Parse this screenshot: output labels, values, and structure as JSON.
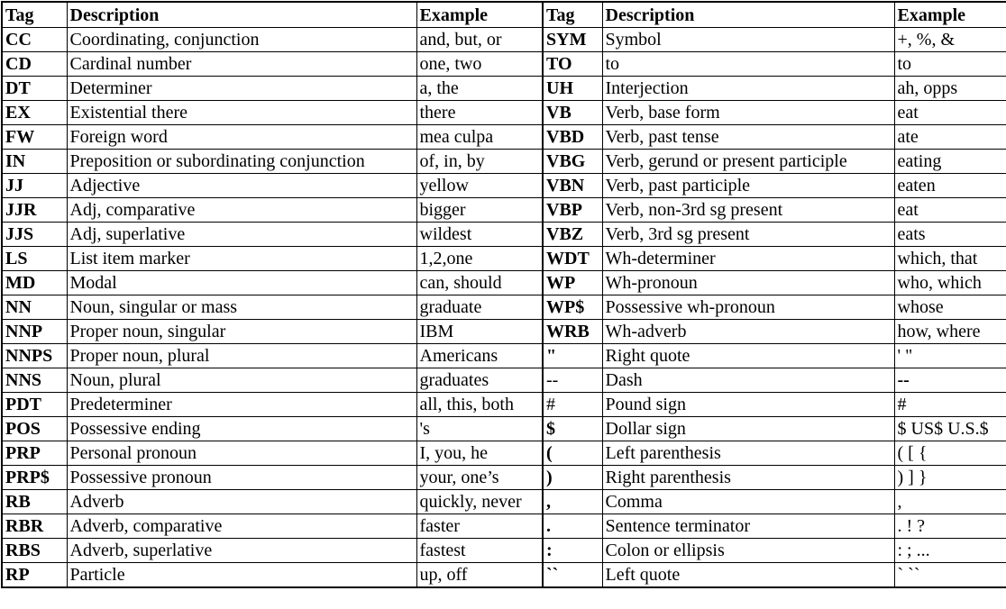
{
  "headers": [
    "Tag",
    "Description",
    "Example",
    "Tag",
    "Description",
    "Example"
  ],
  "rows": [
    {
      "l": {
        "tag": "CC",
        "desc": "Coordinating, conjunction",
        "ex": "and, but, or"
      },
      "r": {
        "tag": "SYM",
        "desc": "Symbol",
        "ex": "+, %, &"
      }
    },
    {
      "l": {
        "tag": "CD",
        "desc": "Cardinal number",
        "ex": "one, two"
      },
      "r": {
        "tag": "TO",
        "desc": "to",
        "ex": "to"
      }
    },
    {
      "l": {
        "tag": "DT",
        "desc": "Determiner",
        "ex": "a, the"
      },
      "r": {
        "tag": "UH",
        "desc": "Interjection",
        "ex": "ah, opps"
      }
    },
    {
      "l": {
        "tag": "EX",
        "desc": "Existential there",
        "ex": "there"
      },
      "r": {
        "tag": "VB",
        "desc": "Verb, base form",
        "ex": "eat"
      }
    },
    {
      "l": {
        "tag": "FW",
        "desc": "Foreign word",
        "ex": "mea culpa"
      },
      "r": {
        "tag": "VBD",
        "desc": "Verb, past tense",
        "ex": "ate"
      }
    },
    {
      "l": {
        "tag": "IN",
        "desc": "Preposition or subordinating conjunction",
        "ex": "of, in, by"
      },
      "r": {
        "tag": "VBG",
        "desc": "Verb, gerund or present participle",
        "ex": "eating"
      }
    },
    {
      "l": {
        "tag": "JJ",
        "desc": "Adjective",
        "ex": "yellow"
      },
      "r": {
        "tag": "VBN",
        "desc": "Verb, past participle",
        "ex": "eaten"
      }
    },
    {
      "l": {
        "tag": "JJR",
        "desc": "Adj, comparative",
        "ex": "bigger"
      },
      "r": {
        "tag": "VBP",
        "desc": "Verb, non-3rd sg  present",
        "ex": "eat"
      }
    },
    {
      "l": {
        "tag": "JJS",
        "desc": "Adj, superlative",
        "ex": "wildest"
      },
      "r": {
        "tag": "VBZ",
        "desc": "Verb, 3rd sg present",
        "ex": "eats"
      }
    },
    {
      "l": {
        "tag": "LS",
        "desc": "List item marker",
        "ex": "1,2,one"
      },
      "r": {
        "tag": "WDT",
        "desc": "Wh-determiner",
        "ex": "which, that"
      }
    },
    {
      "l": {
        "tag": "MD",
        "desc": "Modal",
        "ex": "can, should"
      },
      "r": {
        "tag": "WP",
        "desc": "Wh-pronoun",
        "ex": "who, which"
      }
    },
    {
      "l": {
        "tag": "NN",
        "desc": "Noun, singular or mass",
        "ex": "graduate"
      },
      "r": {
        "tag": "WP$",
        "desc": "Possessive wh-pronoun",
        "ex": "whose"
      }
    },
    {
      "l": {
        "tag": "NNP",
        "desc": "Proper noun, singular",
        "ex": "IBM"
      },
      "r": {
        "tag": "WRB",
        "desc": "Wh-adverb",
        "ex": "how, where"
      }
    },
    {
      "l": {
        "tag": "NNPS",
        "desc": "Proper noun, plural",
        "ex": "Americans"
      },
      "r": {
        "tag": "\"",
        "desc": "Right quote",
        "ex": "' \""
      }
    },
    {
      "l": {
        "tag": "NNS",
        "desc": "Noun, plural",
        "ex": "graduates"
      },
      "r": {
        "tag": "--",
        "desc": "Dash",
        "ex": "--",
        "tagPlain": true,
        "exBold": true
      }
    },
    {
      "l": {
        "tag": "PDT",
        "desc": "Predeterminer",
        "ex": "all, this, both"
      },
      "r": {
        "tag": "#",
        "desc": "Pound sign",
        "ex": "#",
        "tagPlain": true
      }
    },
    {
      "l": {
        "tag": "POS",
        "desc": "Possessive ending",
        "ex": "'s"
      },
      "r": {
        "tag": "$",
        "desc": "Dollar sign",
        "ex": "$ US$ U.S.$"
      }
    },
    {
      "l": {
        "tag": "PRP",
        "desc": "Personal pronoun",
        "ex": "I, you, he"
      },
      "r": {
        "tag": "(",
        "desc": "Left parenthesis",
        "ex": "( [ {"
      }
    },
    {
      "l": {
        "tag": "PRP$",
        "desc": "Possessive pronoun",
        "ex": "your, one’s"
      },
      "r": {
        "tag": ")",
        "desc": "Right parenthesis",
        "ex": ") ] }"
      }
    },
    {
      "l": {
        "tag": "RB",
        "desc": "Adverb",
        "ex": "quickly, never"
      },
      "r": {
        "tag": ",",
        "desc": "Comma",
        "ex": ","
      }
    },
    {
      "l": {
        "tag": "RBR",
        "desc": "Adverb, comparative",
        "ex": "faster"
      },
      "r": {
        "tag": ".",
        "desc": "Sentence terminator",
        "ex": ". ! ?"
      }
    },
    {
      "l": {
        "tag": "RBS",
        "desc": "Adverb, superlative",
        "ex": "fastest"
      },
      "r": {
        "tag": ":",
        "desc": "Colon or ellipsis",
        "ex": ": ; ..."
      }
    },
    {
      "l": {
        "tag": "RP",
        "desc": "Particle",
        "ex": "up, off"
      },
      "r": {
        "tag": "``",
        "desc": "Left quote",
        "ex": "` ``"
      }
    }
  ]
}
